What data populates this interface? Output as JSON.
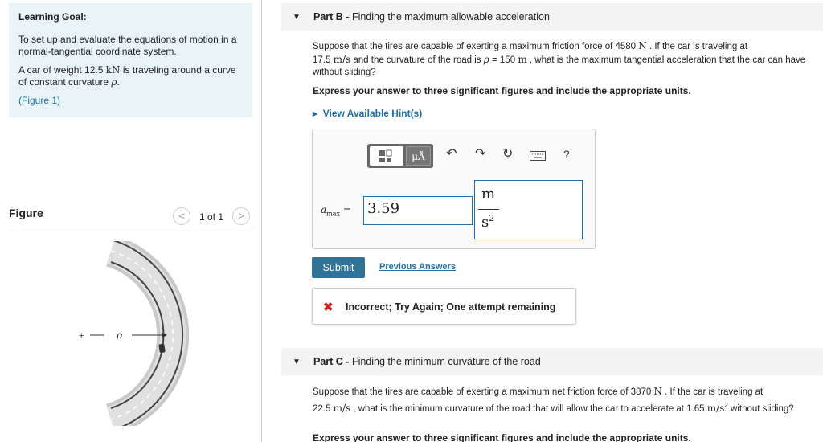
{
  "goal": {
    "title": "Learning Goal:",
    "text1": "To set up and evaluate the equations of motion in a normal-tangential coordinate system.",
    "text2_a": "A car of weight 12.5 ",
    "text2_unit": "kN",
    "text2_b": " is traveling around a curve of constant curvature ",
    "text2_rho": "ρ",
    "text2_end": ".",
    "figure_link": "(Figure 1)"
  },
  "figure": {
    "title": "Figure",
    "pager": "1 of 1",
    "prev": "<",
    "next": ">",
    "rho_label": "ρ",
    "plus_label": "+"
  },
  "partB": {
    "title_bold": "Part B - ",
    "title": "Finding the maximum allowable acceleration",
    "q1": "Suppose that the tires are capable of exerting a maximum friction force of 4580 ",
    "q_unit1": "N",
    "q2": " . If the car is traveling at",
    "q3_val": "17.5 ",
    "q3_unit": "m/s",
    "q4": " and the curvature of the road is ",
    "q_rho": "ρ",
    "q5": " = 150 ",
    "q5_unit": "m",
    "q6": " , what is the maximum tangential acceleration that the car can have without sliding?",
    "instruction": "Express your answer to three significant figures and include the appropriate units.",
    "hint": "View Available Hint(s)",
    "answer_label": "a",
    "answer_sub": "max",
    "answer_eq": " =",
    "answer_value": "3.59",
    "unit_num": "m",
    "unit_den": "s",
    "unit_exp": "2",
    "toolbar": {
      "unit_btn": "μÅ",
      "help": "?"
    },
    "submit": "Submit",
    "previous_answers": "Previous Answers",
    "feedback_icon": "✖",
    "feedback": "Incorrect; Try Again; One attempt remaining"
  },
  "partC": {
    "title_bold": "Part C - ",
    "title": "Finding the minimum curvature of the road",
    "q1": "Suppose that the tires are capable of exerting a maximum net friction force of 3870 ",
    "q_unit1": "N",
    "q2": " . If the car is traveling at",
    "q3_val": "22.5 ",
    "q3_unit": "m/s",
    "q4": " , what is the minimum curvature of the road that will allow the car to accelerate at 1.65 ",
    "q4_unit": "m/s",
    "q4_exp": "2",
    "q5": " without sliding?",
    "instruction": "Express your answer to three significant figures and include the appropriate units."
  },
  "colors": {
    "accent": "#1e6fa8",
    "submit": "#2f7396",
    "goal_bg": "#e8f4f8",
    "error": "#c62828"
  }
}
